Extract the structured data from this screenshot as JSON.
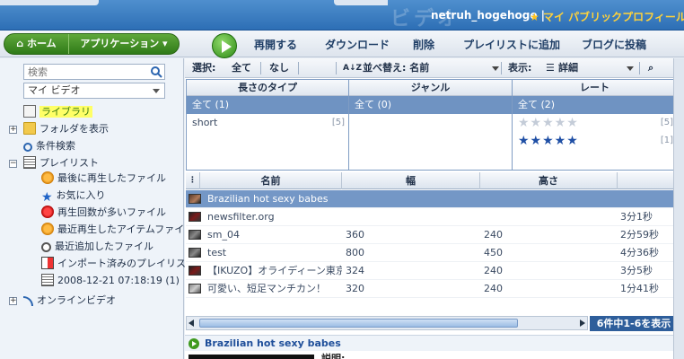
{
  "header": {
    "brand_ghost": "ビデオ",
    "user": "netruh_hogehoge |",
    "profile": "マイ パブリックプロフィール"
  },
  "toolbar": {
    "home": "ホーム",
    "apps": "アプリケーション",
    "actions": [
      "再開する",
      "ダウンロード",
      "削除",
      "プレイリストに追加",
      "ブログに投稿"
    ]
  },
  "sidebar": {
    "search_placeholder": "検索",
    "select_value": "マイ ビデオ",
    "library": "ライブラリ",
    "show_folders": "フォルダを表示",
    "condition_search": "条件検索",
    "playlist": "プレイリスト",
    "playlist_items": [
      "最後に再生したファイル",
      "お気に入り",
      "再生回数が多いファイル",
      "最近再生したアイテムファイル",
      "最近追加したファイル",
      "インポート済みのプレイリスト",
      "2008-12-21 07:18:19  (1)"
    ],
    "online_video": "オンラインビデオ"
  },
  "filter_bar": {
    "select_label": "選択:",
    "all": "全て",
    "none": "なし",
    "sort_label": "並べ替え: 名前",
    "view_label": "表示:",
    "view_value": "詳細"
  },
  "facets": {
    "length": {
      "header": "長さのタイプ",
      "all": "全て (1)",
      "rows": [
        {
          "label": "short",
          "count": "[5]"
        }
      ]
    },
    "genre": {
      "header": "ジャンル",
      "all": "全て (0)"
    },
    "rating": {
      "header": "レート",
      "all": "全て (2)",
      "rows": [
        {
          "stars": "★★★★★",
          "count": "[5]",
          "filled": false
        },
        {
          "stars": "★★★★★",
          "count": "[1]",
          "filled": true
        }
      ]
    }
  },
  "table": {
    "columns": [
      "名前",
      "幅",
      "高さ",
      ""
    ],
    "rows": [
      {
        "name": "Brazilian hot sexy babes",
        "width": "",
        "height": "",
        "duration": ""
      },
      {
        "name": "newsfilter.org",
        "width": "",
        "height": "",
        "duration": "3分1秒"
      },
      {
        "name": "sm_04",
        "width": "360",
        "height": "240",
        "duration": "2分59秒"
      },
      {
        "name": "test",
        "width": "800",
        "height": "450",
        "duration": "4分36秒"
      },
      {
        "name": "【IKUZO】オライディーン東京さ",
        "width": "324",
        "height": "240",
        "duration": "3分5秒"
      },
      {
        "name": "可愛い、短足マンチカン！",
        "width": "320",
        "height": "240",
        "duration": "1分41秒"
      }
    ]
  },
  "paging": "6件中1-6を表示",
  "detail": {
    "title": "Brazilian hot sexy babes",
    "desc_label": "説明:"
  }
}
